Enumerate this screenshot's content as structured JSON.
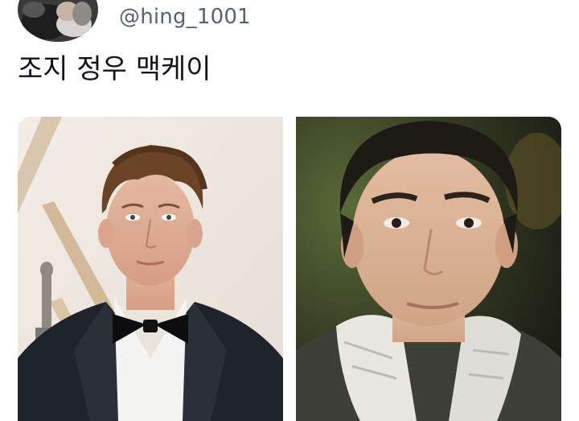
{
  "tweet": {
    "handle": "@hing_1001",
    "text": "조지 정우 맥케이"
  },
  "media": {
    "photos": [
      {
        "subject": "man-in-tuxedo-bow-tie"
      },
      {
        "subject": "man-in-dark-coat-white-scarf"
      }
    ]
  },
  "colors": {
    "handle": "#536471",
    "text": "#0f1419",
    "background": "#ffffff"
  }
}
